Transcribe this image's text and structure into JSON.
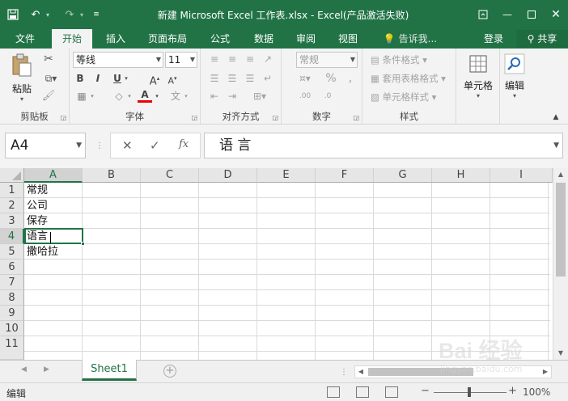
{
  "title_bar": {
    "title": "新建 Microsoft Excel 工作表.xlsx - Excel(产品激活失败)",
    "save_icon": "save-icon",
    "undo_icon": "undo-icon",
    "redo_icon": "redo-icon",
    "customize_icon": "customize-qat-icon"
  },
  "tabs": [
    {
      "label": "文件"
    },
    {
      "label": "开始"
    },
    {
      "label": "插入"
    },
    {
      "label": "页面布局"
    },
    {
      "label": "公式"
    },
    {
      "label": "数据"
    },
    {
      "label": "审阅"
    },
    {
      "label": "视图"
    },
    {
      "label": "告诉我..."
    }
  ],
  "account": {
    "login": "登录",
    "share": "共享"
  },
  "ribbon": {
    "clipboard": {
      "paste": "粘贴",
      "label": "剪贴板"
    },
    "font": {
      "name": "等线",
      "size": "11",
      "bold": "B",
      "italic": "I",
      "underline": "U",
      "grow": "A",
      "shrink": "A",
      "font_color": "A",
      "label": "字体"
    },
    "alignment": {
      "label": "对齐方式"
    },
    "number": {
      "format": "常规",
      "label": "数字"
    },
    "styles": {
      "conditional": "条件格式",
      "table": "套用表格格式",
      "cell": "单元格样式",
      "label": "样式"
    },
    "cells": {
      "label": "单元格"
    },
    "editing": {
      "label": "编辑"
    }
  },
  "formula_bar": {
    "name_box": "A4",
    "content": "语 言",
    "fx": "fx"
  },
  "grid": {
    "columns": [
      "A",
      "B",
      "C",
      "D",
      "E",
      "F",
      "G",
      "H",
      "I"
    ],
    "rows": [
      "1",
      "2",
      "3",
      "4",
      "5",
      "6",
      "7",
      "8",
      "9",
      "10",
      "11"
    ],
    "cells": [
      "常规",
      "公司",
      "保存",
      "语言",
      "撒哈拉"
    ],
    "selected_cell": "A4"
  },
  "sheets": {
    "active": "Sheet1"
  },
  "status": {
    "mode": "编辑",
    "zoom": "100%"
  },
  "watermark": {
    "line1": "Bai 经验",
    "line2": "jingyan.baidu.com"
  },
  "colors": {
    "accent": "#217346"
  }
}
